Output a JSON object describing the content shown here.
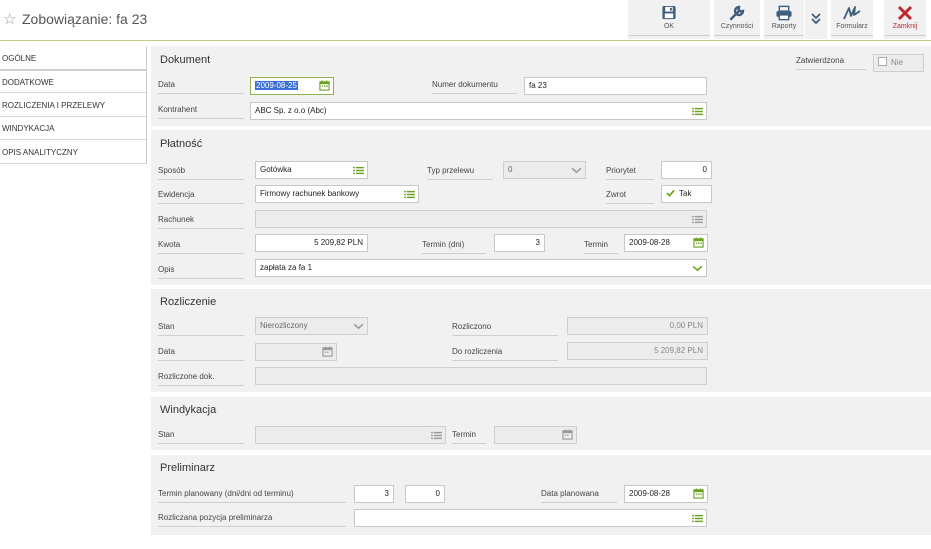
{
  "header": {
    "title": "Zobowiązanie: fa 23",
    "toolbar": {
      "ok": "OK",
      "czynnosci": "Czynności",
      "raporty": "Raporty",
      "formularz": "Formularz",
      "zamknij": "Zamknij"
    }
  },
  "sidebar": {
    "items": [
      {
        "label": "OGÓLNE"
      },
      {
        "label": "DODATKOWE"
      },
      {
        "label": "ROZLICZENIA I PRZELEWY"
      },
      {
        "label": "WINDYKACJA"
      },
      {
        "label": "OPIS ANALITYCZNY"
      }
    ]
  },
  "dokument": {
    "title": "Dokument",
    "data_label": "Data",
    "data_value": "2009-08-25",
    "numer_label": "Numer dokumentu",
    "numer_value": "fa 23",
    "kontrahent_label": "Kontrahent",
    "kontrahent_value": "ABC Sp. z o.o (Abc)",
    "zatwierdzona_label": "Zatwierdzona",
    "zatwierdzona_value": "Nie"
  },
  "platnosc": {
    "title": "Płatność",
    "sposob_label": "Sposób",
    "sposob_value": "Gotówka",
    "typ_label": "Typ przelewu",
    "typ_value": "0",
    "priorytet_label": "Priorytet",
    "priorytet_value": "0",
    "ewidencja_label": "Ewidencja",
    "ewidencja_value": "Firmowy rachunek bankowy",
    "zwrot_label": "Zwrot",
    "zwrot_value": "Tak",
    "rachunek_label": "Rachunek",
    "rachunek_value": "",
    "kwota_label": "Kwota",
    "kwota_value": "5 209,82 PLN",
    "termin_dni_label": "Termin (dni)",
    "termin_dni_value": "3",
    "termin_label": "Termin",
    "termin_value": "2009-08-28",
    "opis_label": "Opis",
    "opis_value": "zapłata za fa 1"
  },
  "rozliczenie": {
    "title": "Rozliczenie",
    "stan_label": "Stan",
    "stan_value": "Nierozliczony",
    "rozliczono_label": "Rozliczono",
    "rozliczono_value": "0,00 PLN",
    "data_label": "Data",
    "data_value": "",
    "do_rozliczenia_label": "Do rozliczenia",
    "do_rozliczenia_value": "5 209,82 PLN",
    "rozliczone_dok_label": "Rozliczone dok.",
    "rozliczone_dok_value": ""
  },
  "windykacja": {
    "title": "Windykacja",
    "stan_label": "Stan",
    "stan_value": "",
    "termin_label": "Termin",
    "termin_value": ""
  },
  "preliminarz": {
    "title": "Preliminarz",
    "termin_planowany_label": "Termin planowany (dni/dni od terminu)",
    "termin_planowany_value1": "3",
    "termin_planowany_value2": "0",
    "data_planowana_label": "Data planowana",
    "data_planowana_value": "2009-08-28",
    "rozliczana_label": "Rozliczana pozycja preliminarza",
    "rozliczana_value": ""
  },
  "colors": {
    "accent_green": "#6aa121",
    "close_red": "#c0272d",
    "toolbar_blue": "#3f5d7c",
    "section_bg": "#f1f1f1"
  },
  "icons": [
    "star-icon",
    "save-icon",
    "wrench-icon",
    "printer-icon",
    "double-chevron-down-icon",
    "signature-icon",
    "close-icon",
    "calendar-icon",
    "list-icon",
    "chevron-down-icon",
    "checkmark-icon",
    "checkbox-icon"
  ]
}
